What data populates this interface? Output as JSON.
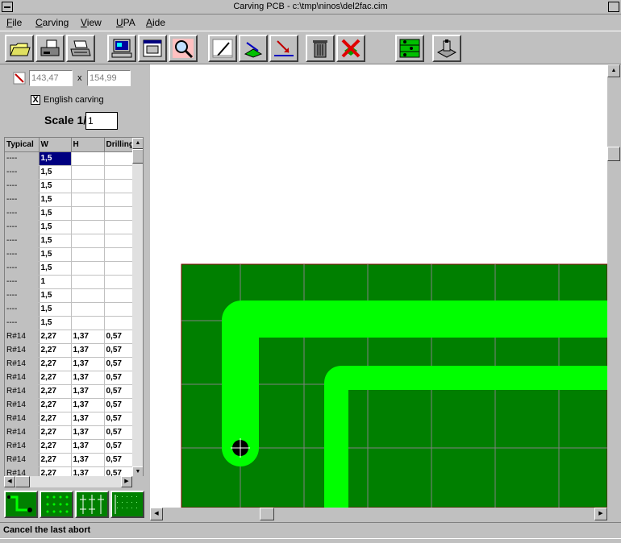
{
  "window": {
    "title": "Carving PCB - c:\\tmp\\ninos\\del2fac.cim"
  },
  "menu": {
    "items": [
      "File",
      "Carving",
      "View",
      "UPA",
      "Aide"
    ]
  },
  "size": {
    "width": "143,47",
    "x_label": "x",
    "height": "154,99"
  },
  "english_carving": {
    "label": "English carving",
    "checked": "X"
  },
  "scale": {
    "label": "Scale 1/",
    "value": "1"
  },
  "grid": {
    "headers": [
      "Typical",
      "W",
      "H",
      "Drilling"
    ],
    "rows": [
      [
        "----",
        "1,5",
        "",
        ""
      ],
      [
        "----",
        "1,5",
        "",
        ""
      ],
      [
        "----",
        "1,5",
        "",
        ""
      ],
      [
        "----",
        "1,5",
        "",
        ""
      ],
      [
        "----",
        "1,5",
        "",
        ""
      ],
      [
        "----",
        "1,5",
        "",
        ""
      ],
      [
        "----",
        "1,5",
        "",
        ""
      ],
      [
        "----",
        "1,5",
        "",
        ""
      ],
      [
        "----",
        "1,5",
        "",
        ""
      ],
      [
        "----",
        "1",
        "",
        ""
      ],
      [
        "----",
        "1,5",
        "",
        ""
      ],
      [
        "----",
        "1,5",
        "",
        ""
      ],
      [
        "----",
        "1,5",
        "",
        ""
      ],
      [
        "R#14",
        "2,27",
        "1,37",
        "0,57"
      ],
      [
        "R#14",
        "2,27",
        "1,37",
        "0,57"
      ],
      [
        "R#14",
        "2,27",
        "1,37",
        "0,57"
      ],
      [
        "R#14",
        "2,27",
        "1,37",
        "0,57"
      ],
      [
        "R#14",
        "2,27",
        "1,37",
        "0,57"
      ],
      [
        "R#14",
        "2,27",
        "1,37",
        "0,57"
      ],
      [
        "R#14",
        "2,27",
        "1,37",
        "0,57"
      ],
      [
        "R#14",
        "2,27",
        "1,37",
        "0,57"
      ],
      [
        "R#14",
        "2,27",
        "1,37",
        "0,57"
      ],
      [
        "R#14",
        "2,27",
        "1,37",
        "0,57"
      ],
      [
        "R#14",
        "2,27",
        "1,37",
        "0,57"
      ]
    ]
  },
  "status": {
    "text": "Cancel the last abort"
  },
  "colors": {
    "board": "#007f00",
    "track": "#00ff00",
    "grid_line": "#808080",
    "selection": "#000080"
  }
}
